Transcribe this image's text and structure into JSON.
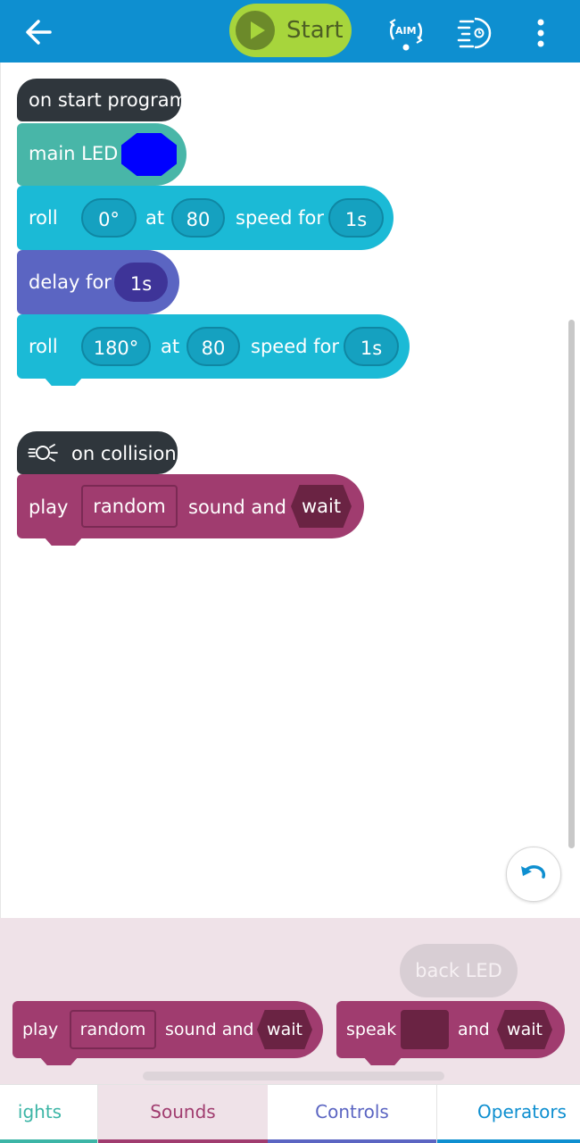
{
  "toolbar": {
    "back_icon": "arrow-left-icon",
    "start_label": "Start",
    "aim_label": "AIM",
    "sensor_icon": "sensor-control-icon",
    "more_icon": "more-vertical-icon"
  },
  "program": {
    "start_hat": "on start program",
    "main_led": {
      "label": "main LED",
      "color": "#0000ff"
    },
    "roll1": {
      "label": "roll",
      "heading": "0°",
      "at": "at",
      "speed": "80",
      "speed_for": "speed for",
      "duration": "1s"
    },
    "delay": {
      "label": "delay for",
      "duration": "1s"
    },
    "roll2": {
      "label": "roll",
      "heading": "180°",
      "at": "at",
      "speed": "80",
      "speed_for": "speed for",
      "duration": "1s"
    },
    "collision_hat": "on collision",
    "play": {
      "label": "play",
      "sound": "random",
      "sound_and": "sound and",
      "wait": "wait"
    }
  },
  "palette": {
    "back_led": "back LED",
    "play": {
      "label": "play",
      "sound": "random",
      "sound_and": "sound and",
      "wait": "wait"
    },
    "speak": {
      "label": "speak",
      "and": "and",
      "wait": "wait"
    }
  },
  "categories": [
    {
      "label": "ights",
      "color": "#3cb5a6"
    },
    {
      "label": "Sounds",
      "color": "#a03c6f",
      "selected": true
    },
    {
      "label": "Controls",
      "color": "#5b65c2"
    },
    {
      "label": "Operators",
      "color": "#0e8fd0"
    }
  ],
  "colors": {
    "toolbar": "#0e8fd0",
    "start": "#a7d53c",
    "hat": "#2f363c",
    "lights": "#48b6a8",
    "movements": "#1bbad6",
    "controls": "#5b65c2",
    "sounds": "#a03c6f"
  }
}
